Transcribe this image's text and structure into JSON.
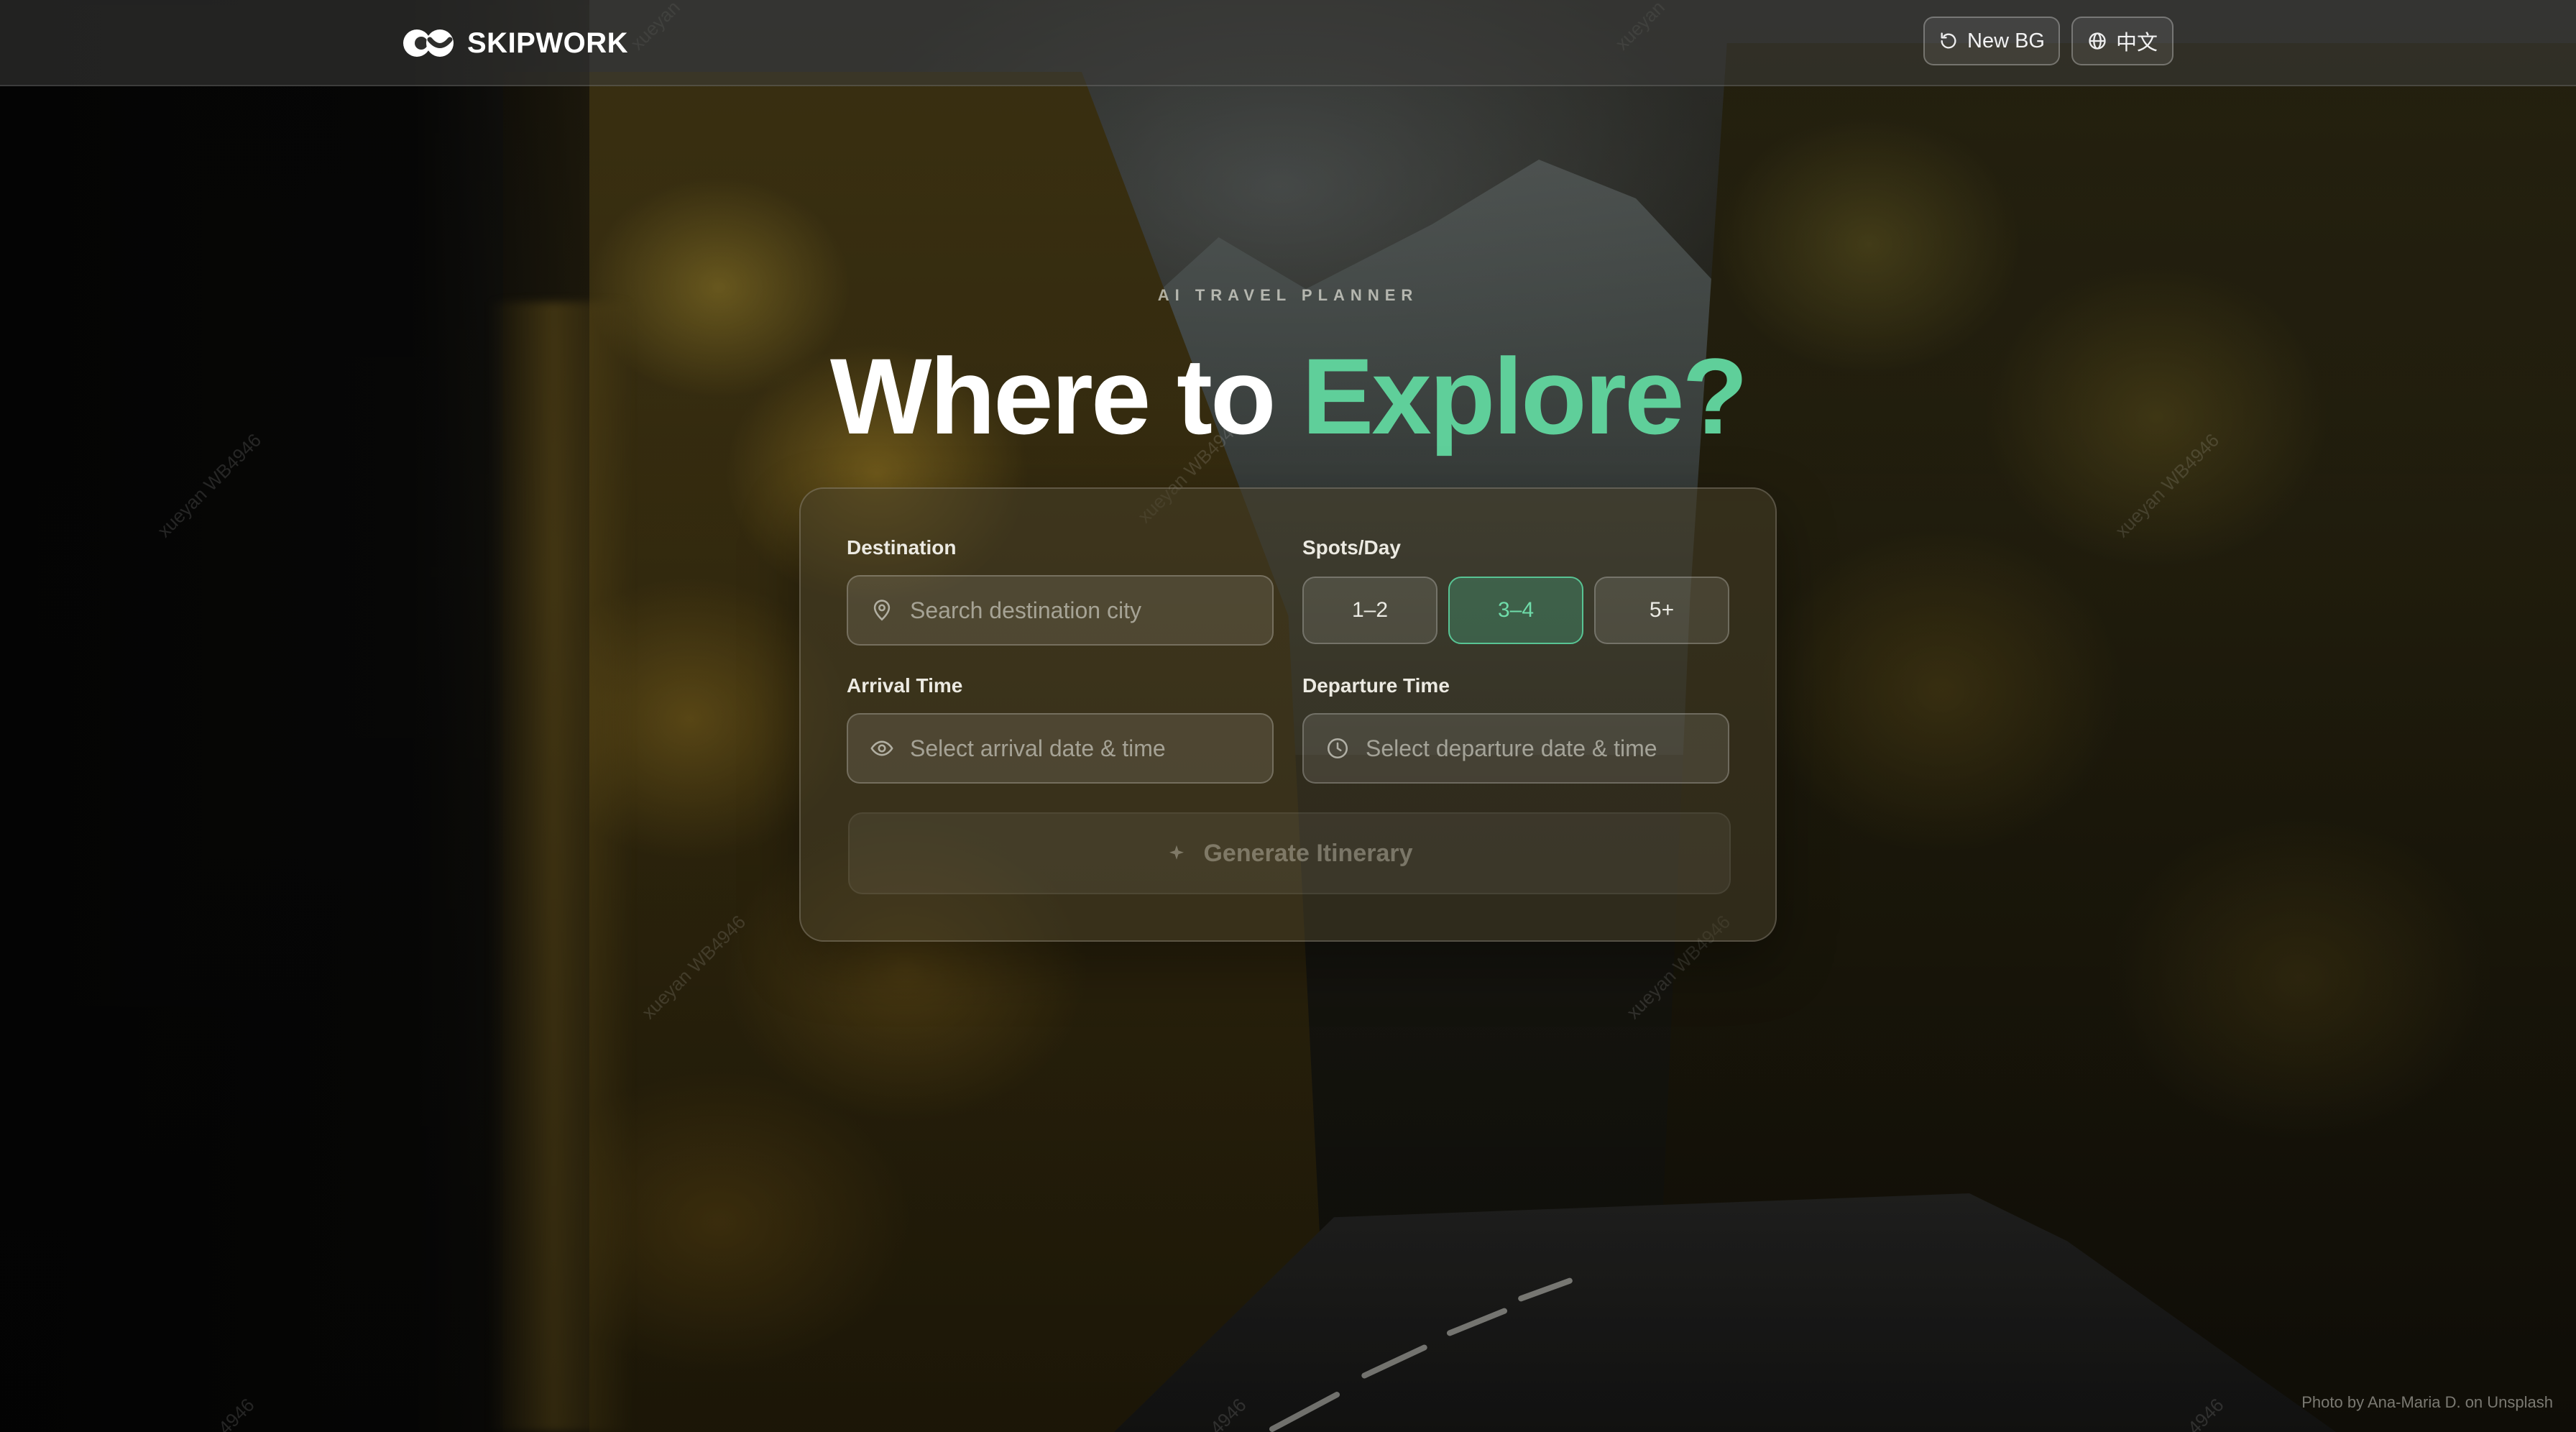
{
  "header": {
    "brand_name": "SKIPWORK",
    "logo_icon": "skipwork-logo",
    "new_bg_label": "New BG",
    "new_bg_icon": "refresh-icon",
    "language_label": "中文",
    "language_icon": "globe-icon"
  },
  "hero": {
    "eyebrow": "AI TRAVEL PLANNER",
    "title_part1": "Where to ",
    "title_part2": "Explore?"
  },
  "form": {
    "destination": {
      "label": "Destination",
      "placeholder": "Search destination city",
      "value": "",
      "icon": "location-pin-icon"
    },
    "spots_per_day": {
      "label": "Spots/Day",
      "options": [
        "1–2",
        "3–4",
        "5+"
      ],
      "selected": "3–4"
    },
    "arrival_time": {
      "label": "Arrival Time",
      "placeholder": "Select arrival date & time",
      "value": "",
      "icon": "eye-icon"
    },
    "departure_time": {
      "label": "Departure Time",
      "placeholder": "Select departure date & time",
      "value": "",
      "icon": "clock-icon"
    },
    "generate_button": {
      "label": "Generate Itinerary",
      "icon": "sparkle-icon",
      "enabled": false
    }
  },
  "footer": {
    "credit": "Photo by Ana-Maria D. on Unsplash"
  },
  "watermark": {
    "user": "xueyan",
    "id": "WB4946",
    "partial": "4946"
  },
  "colors": {
    "accent_green": "#5fcf9a",
    "active_border": "#58c494",
    "card_bg": "rgba(70,62,40,0.55)"
  }
}
